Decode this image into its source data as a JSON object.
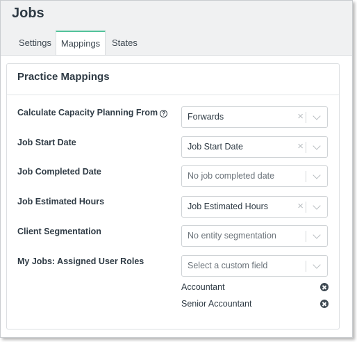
{
  "page": {
    "title": "Jobs"
  },
  "tabs": [
    {
      "label": "Settings",
      "active": false
    },
    {
      "label": "Mappings",
      "active": true
    },
    {
      "label": "States",
      "active": false
    }
  ],
  "card": {
    "title": "Practice Mappings"
  },
  "fields": [
    {
      "label": "Calculate Capacity Planning From",
      "help_icon": "question-circle-icon",
      "value": "Forwards",
      "is_placeholder": false,
      "clearable": true
    },
    {
      "label": "Job Start Date",
      "value": "Job Start Date",
      "is_placeholder": false,
      "clearable": true
    },
    {
      "label": "Job Completed Date",
      "value": "No job completed date",
      "is_placeholder": true,
      "clearable": false
    },
    {
      "label": "Job Estimated Hours",
      "value": "Job Estimated Hours",
      "is_placeholder": false,
      "clearable": true
    },
    {
      "label": "Client Segmentation",
      "value": "No entity segmentation",
      "is_placeholder": true,
      "clearable": false
    },
    {
      "label": "My Jobs: Assigned User Roles",
      "value": "Select a custom field",
      "is_placeholder": true,
      "clearable": false
    }
  ],
  "assigned_roles": [
    {
      "label": "Accountant"
    },
    {
      "label": "Senior Accountant"
    }
  ],
  "icons": {
    "clear": "×",
    "dropdown": "chevron-down-icon",
    "remove": "remove-circle-icon"
  },
  "colors": {
    "active_tab_accent": "#52c29a",
    "text": "#2f3b45",
    "header_bg": "#f0f1f2"
  }
}
